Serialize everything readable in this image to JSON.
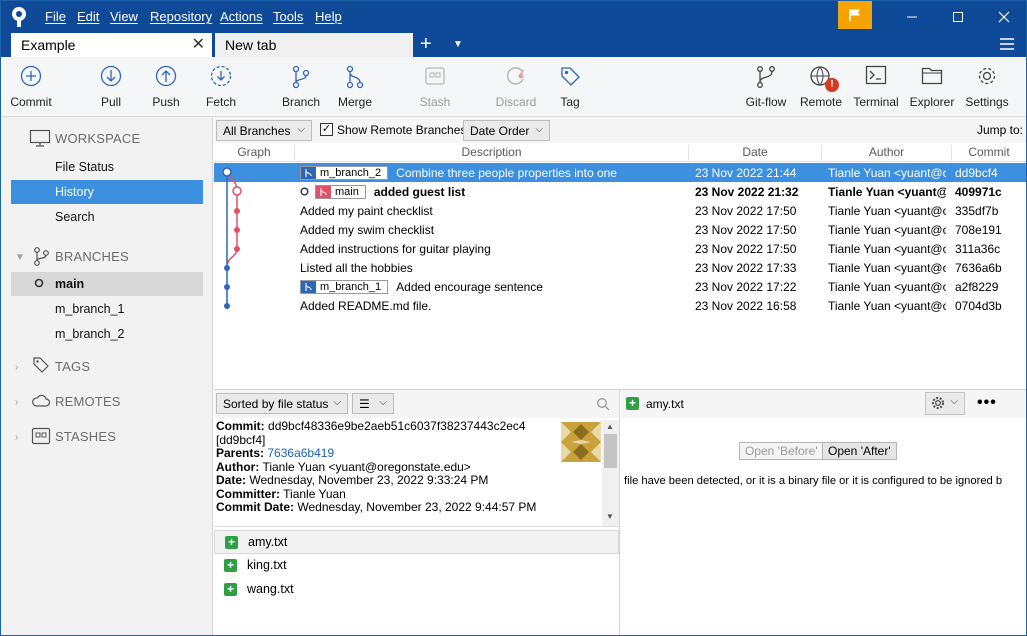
{
  "menu": [
    "File",
    "Edit",
    "View",
    "Repository",
    "Actions",
    "Tools",
    "Help"
  ],
  "tabs": {
    "active": "Example",
    "new": "New tab",
    "add": "+"
  },
  "toolbar": {
    "commit": "Commit",
    "pull": "Pull",
    "push": "Push",
    "fetch": "Fetch",
    "branch": "Branch",
    "merge": "Merge",
    "stash": "Stash",
    "discard": "Discard",
    "tag": "Tag",
    "gitflow": "Git-flow",
    "remote": "Remote",
    "terminal": "Terminal",
    "explorer": "Explorer",
    "settings": "Settings",
    "remote_badge": "!"
  },
  "sidebar": {
    "workspace": "WORKSPACE",
    "file_status": "File Status",
    "history": "History",
    "search": "Search",
    "branches": "BRANCHES",
    "branch_items": [
      "main",
      "m_branch_1",
      "m_branch_2"
    ],
    "tags": "TAGS",
    "remotes": "REMOTES",
    "stashes": "STASHES"
  },
  "filter": {
    "branches": "All Branches",
    "show_remote": "Show Remote Branches",
    "order": "Date Order",
    "jump": "Jump to:"
  },
  "columns": {
    "graph": "Graph",
    "description": "Description",
    "date": "Date",
    "author": "Author",
    "commit": "Commit"
  },
  "commits": [
    {
      "tag": "m_branch_2",
      "desc": "Combine three people properties into one",
      "date": "23 Nov 2022 21:44",
      "author": "Tianle Yuan <yuant@o",
      "hash": "dd9bcf4"
    },
    {
      "tag": "main",
      "desc": "added guest list",
      "date": "23 Nov 2022 21:32",
      "author": "Tianle Yuan <yuant@",
      "hash": "409971c"
    },
    {
      "tag": "",
      "desc": "Added my paint checklist",
      "date": "23 Nov 2022 17:50",
      "author": "Tianle Yuan <yuant@o",
      "hash": "335df7b"
    },
    {
      "tag": "",
      "desc": "Added my swim checklist",
      "date": "23 Nov 2022 17:50",
      "author": "Tianle Yuan <yuant@o",
      "hash": "708e191"
    },
    {
      "tag": "",
      "desc": "Added instructions for guitar playing",
      "date": "23 Nov 2022 17:50",
      "author": "Tianle Yuan <yuant@o",
      "hash": "311a36c"
    },
    {
      "tag": "",
      "desc": "Listed all the hobbies",
      "date": "23 Nov 2022 17:33",
      "author": "Tianle Yuan <yuant@o",
      "hash": "7636a6b"
    },
    {
      "tag": "m_branch_1",
      "desc": "Added encourage sentence",
      "date": "23 Nov 2022 17:22",
      "author": "Tianle Yuan <yuant@o",
      "hash": "a2f8229"
    },
    {
      "tag": "",
      "desc": "Added README.md file.",
      "date": "23 Nov 2022 16:58",
      "author": "Tianle Yuan <yuant@o",
      "hash": "0704d3b"
    }
  ],
  "details": {
    "sort": "Sorted by file status",
    "commit_label": "Commit:",
    "commit_value": "dd9bcf48336e9be2aeb51c6037f38237443c2ec4",
    "commit_short": "[dd9bcf4]",
    "parents_label": "Parents:",
    "parents_value": "7636a6b419",
    "author_label": "Author:",
    "author_value": "Tianle Yuan <yuant@oregonstate.edu>",
    "date_label": "Date:",
    "date_value": "Wednesday, November 23, 2022 9:33:24 PM",
    "committer_label": "Committer:",
    "committer_value": "Tianle Yuan",
    "commitdate_label": "Commit Date:",
    "commitdate_value": "Wednesday, November 23, 2022 9:44:57 PM"
  },
  "files": [
    "amy.txt",
    "king.txt",
    "wang.txt"
  ],
  "diff": {
    "file": "amy.txt",
    "open_before": "Open 'Before'",
    "open_after": "Open 'After'",
    "message": "file have been detected, or it is a binary file or it is configured to be ignored b"
  },
  "colors": {
    "titlebar": "#0f4a99",
    "selection": "#3d8fe0",
    "accent_red": "#e0506a",
    "accent_blue": "#2e66b8",
    "flag": "#f5a300",
    "added": "#2ea043"
  }
}
